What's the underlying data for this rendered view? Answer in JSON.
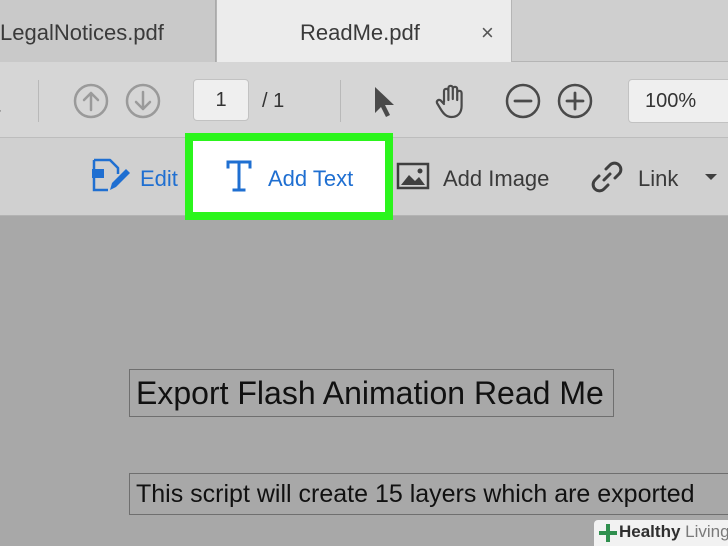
{
  "tabs": {
    "inactive_label": "LegalNotices.pdf",
    "active_label": "ReadMe.pdf",
    "close_glyph": "×"
  },
  "toolbar": {
    "page_current": "1",
    "page_total": "/ 1",
    "zoom": "100%",
    "icons": [
      "page-up-icon",
      "page-down-icon",
      "select-pointer-icon",
      "hand-tool-icon",
      "zoom-out-icon",
      "zoom-in-icon"
    ]
  },
  "edit_toolbar": {
    "edit_label": "Edit",
    "add_text_label": "Add Text",
    "add_image_label": "Add Image",
    "link_label": "Link",
    "highlight_color": "#2bf51c",
    "accent_color": "#1f6fd1"
  },
  "document": {
    "title": "Export Flash Animation Read Me",
    "body": "This script will create 15 layers which are exported"
  },
  "watermark": {
    "brand_bold": "Healthy",
    "brand_light": "Living"
  }
}
